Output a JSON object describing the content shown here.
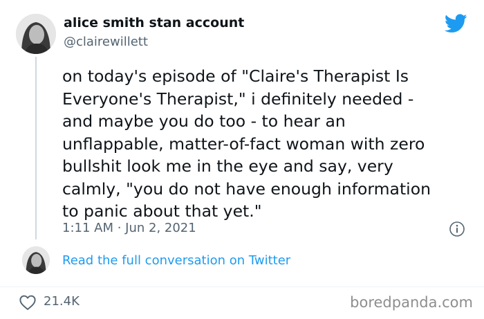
{
  "author": {
    "display_name": "alice smith stan account",
    "handle": "@clairewillett",
    "avatar": "avatar-photo"
  },
  "tweet": {
    "text": "on today's episode of \"Claire's Therapist Is\nEveryone's Therapist,\" i definitely needed -\nand maybe you do too - to hear an\nunflappable, matter-of-fact woman with zero\nbullshit look me in the eye and say, very\ncalmly, \"you do not have enough information\nto panic about that yet.\"",
    "timestamp": "1:11 AM · Jun 2, 2021"
  },
  "conversation": {
    "link_label": "Read the full conversation on Twitter"
  },
  "engagement": {
    "likes": "21.4K"
  },
  "watermark": "boredpanda.com",
  "icons": [
    "twitter-bird-icon",
    "info-icon",
    "heart-icon"
  ],
  "colors": {
    "link": "#1d9bf0",
    "twitter_blue": "#1d9bf0",
    "secondary_text": "#536471",
    "primary_text": "#0f1419",
    "thread_line": "#cfd9de"
  }
}
